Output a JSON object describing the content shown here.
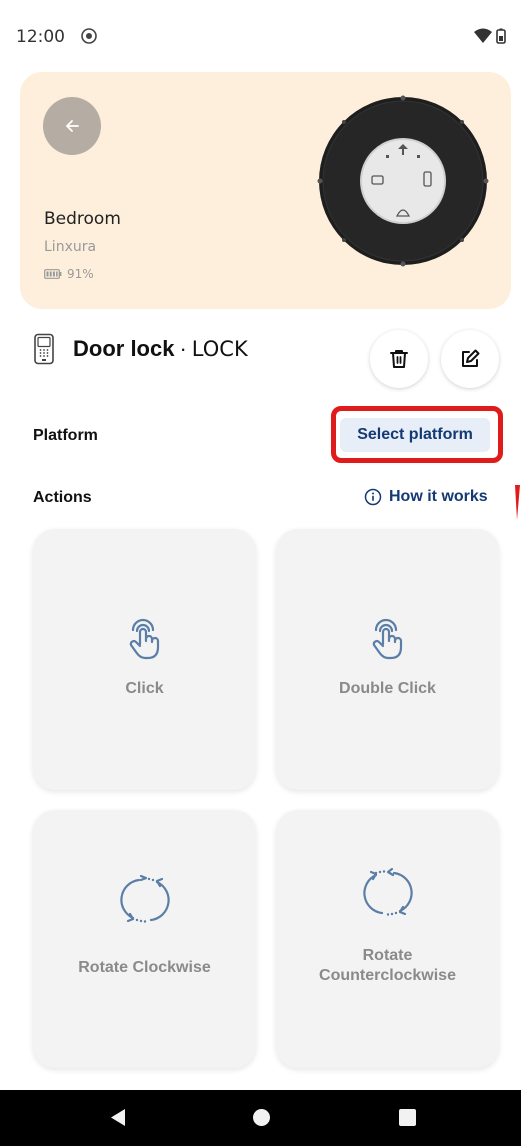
{
  "status_bar": {
    "time": "12:00"
  },
  "device": {
    "room": "Bedroom",
    "brand": "Linxura",
    "battery": "91%"
  },
  "title": {
    "name": "Door lock",
    "separator": "·",
    "type": "LOCK"
  },
  "platform": {
    "label": "Platform",
    "button": "Select platform"
  },
  "actions": {
    "label": "Actions",
    "how_it_works": "How it works",
    "cards": [
      {
        "label": "Click",
        "icon": "tap-hand-icon"
      },
      {
        "label": "Double Click",
        "icon": "tap-hand-icon"
      },
      {
        "label": "Rotate Clockwise",
        "icon": "rotate-clockwise-icon"
      },
      {
        "label_line1": "Rotate",
        "label_line2": "Counterclockwise",
        "icon": "rotate-counterclockwise-icon"
      }
    ]
  },
  "colors": {
    "hero_bg": "#fdefdc",
    "accent_navy": "#143a73",
    "highlight_red": "#e01b1b",
    "icon_blue": "#5a7ea6",
    "card_bg": "#f3f3f3"
  }
}
